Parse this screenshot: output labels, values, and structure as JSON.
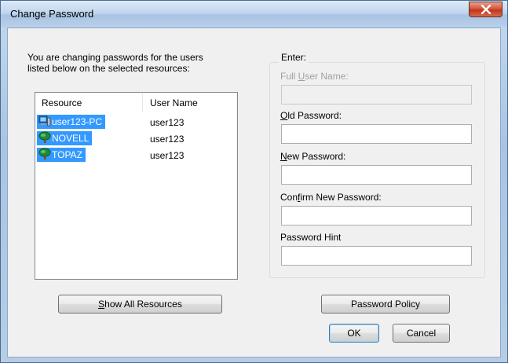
{
  "window": {
    "title": "Change Password"
  },
  "intro": {
    "line1": "You are changing passwords for the users",
    "line2": "listed below on the selected resources:"
  },
  "resources": {
    "columns": {
      "resource": "Resource",
      "user": "User Name"
    },
    "rows": [
      {
        "name": "user123-PC",
        "user": "user123",
        "icon": "computer-icon"
      },
      {
        "name": "NOVELL",
        "user": "user123",
        "icon": "network-tree-icon"
      },
      {
        "name": "TOPAZ",
        "user": "user123",
        "icon": "network-tree-icon"
      }
    ]
  },
  "enter": {
    "legend": "Enter:",
    "full_name": {
      "pre": "Full ",
      "key": "U",
      "post": "ser Name:",
      "value": ""
    },
    "old_password": {
      "pre": "",
      "key": "O",
      "post": "ld Password:",
      "value": ""
    },
    "new_password": {
      "pre": "",
      "key": "N",
      "post": "ew Password:",
      "value": ""
    },
    "confirm_password": {
      "pre": "Con",
      "key": "f",
      "post": "irm New Password:",
      "value": ""
    },
    "password_hint": {
      "label": "Password Hint",
      "value": ""
    }
  },
  "buttons": {
    "show_all": {
      "key": "S",
      "post": "how All Resources"
    },
    "password_policy": "Password Policy",
    "ok": "OK",
    "cancel": "Cancel"
  },
  "colors": {
    "selection": "#3399ff",
    "close_button": "#c1361a"
  }
}
